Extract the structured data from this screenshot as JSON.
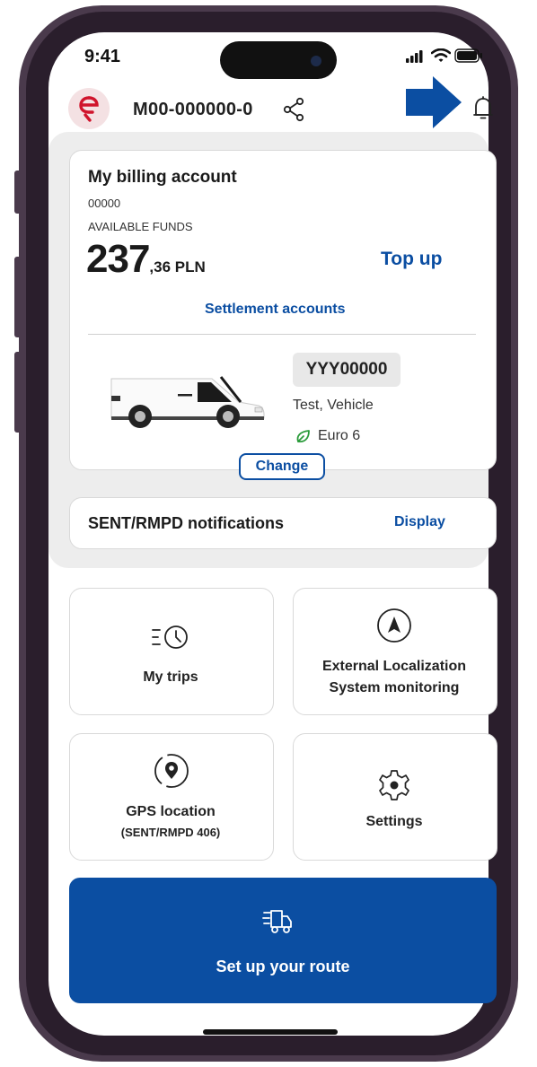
{
  "status_bar": {
    "time": "9:41"
  },
  "header": {
    "account_id": "M00-000000-0"
  },
  "billing": {
    "title": "My billing account",
    "number": "00000",
    "funds_label": "AVAILABLE FUNDS",
    "amount_int": "237",
    "amount_rest": ",36 PLN",
    "top_up": "Top up",
    "settlement_link": "Settlement accounts"
  },
  "vehicle": {
    "plate": "YYY00000",
    "name": "Test, Vehicle",
    "emission": "Euro 6",
    "change_label": "Change"
  },
  "notifications": {
    "label": "SENT/RMPD notifications",
    "action": "Display"
  },
  "tiles": [
    {
      "label": "My trips",
      "icon": "history-clock-icon"
    },
    {
      "label_line1": "External Localization",
      "label_line2": "System monitoring",
      "icon": "navigation-arrow-icon"
    },
    {
      "label_line1": "GPS location",
      "label_line2": "(SENT/RMPD 406)",
      "icon": "location-pin-icon"
    },
    {
      "label": "Settings",
      "icon": "gear-icon"
    }
  ],
  "route": {
    "label": "Set up your route",
    "icon": "delivery-truck-icon"
  },
  "colors": {
    "primary": "#0b4ea2",
    "brand_red": "#d0142c",
    "frame": "#4a3a4c"
  }
}
